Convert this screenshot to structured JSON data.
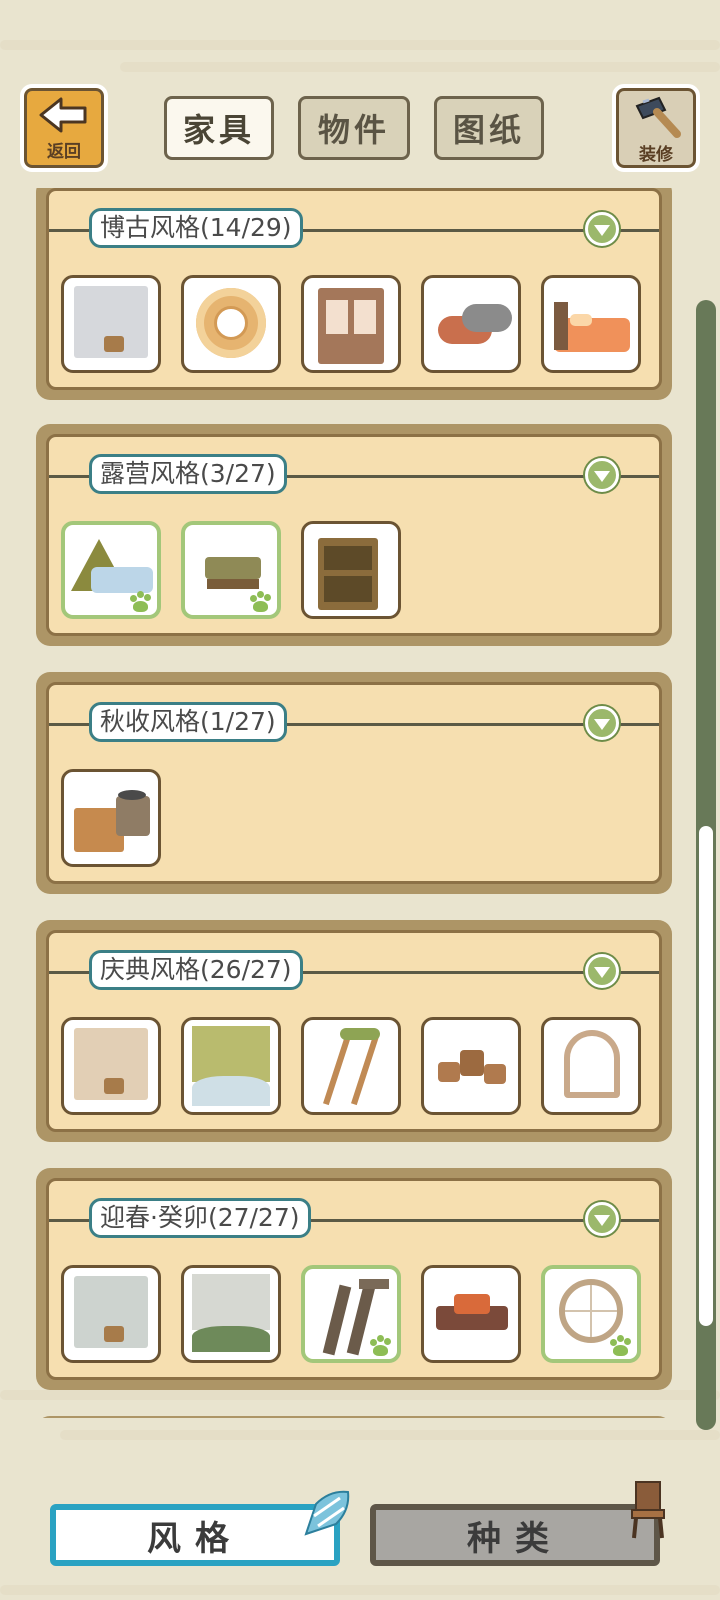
{
  "header": {
    "back_label": "返回",
    "decorate_label": "装修",
    "tabs": [
      {
        "label": "家具",
        "active": true
      },
      {
        "label": "物件",
        "active": false
      },
      {
        "label": "图纸",
        "active": false
      }
    ]
  },
  "groups": [
    {
      "title": "博古风格(14/29)",
      "items": [
        {
          "icon": "wall-wood-icon",
          "owned": false
        },
        {
          "icon": "round-rug-icon",
          "owned": false
        },
        {
          "icon": "lattice-door-icon",
          "owned": false
        },
        {
          "icon": "rolled-mats-icon",
          "owned": false
        },
        {
          "icon": "bed-icon",
          "owned": false
        }
      ]
    },
    {
      "title": "露营风格(3/27)",
      "items": [
        {
          "icon": "tent-bed-icon",
          "owned": true
        },
        {
          "icon": "camp-stool-icon",
          "owned": true
        },
        {
          "icon": "camp-shelf-icon",
          "owned": false
        }
      ]
    },
    {
      "title": "秋收风格(1/27)",
      "items": [
        {
          "icon": "harvest-stove-icon",
          "owned": false
        }
      ]
    },
    {
      "title": "庆典风格(26/27)",
      "items": [
        {
          "icon": "wall-plank-icon",
          "owned": false
        },
        {
          "icon": "grass-floor-icon",
          "owned": false
        },
        {
          "icon": "ladder-icon",
          "owned": false
        },
        {
          "icon": "stools-icon",
          "owned": false
        },
        {
          "icon": "arched-window-icon",
          "owned": false
        }
      ]
    },
    {
      "title": "迎春·癸卯(27/27)",
      "items": [
        {
          "icon": "wall-stone-icon",
          "owned": false
        },
        {
          "icon": "stone-floor-icon",
          "owned": false
        },
        {
          "icon": "stone-stairs-icon",
          "owned": true
        },
        {
          "icon": "firewood-icon",
          "owned": false
        },
        {
          "icon": "round-window-icon",
          "owned": true
        }
      ]
    }
  ],
  "bottom_tabs": [
    {
      "label": "风格",
      "active": true
    },
    {
      "label": "种类",
      "active": false
    }
  ],
  "colors": {
    "background": "#e9e4cf",
    "panel": "#f6dfb0",
    "owned_border": "#a3c77a",
    "active_tab_border": "#2aa2c2"
  }
}
